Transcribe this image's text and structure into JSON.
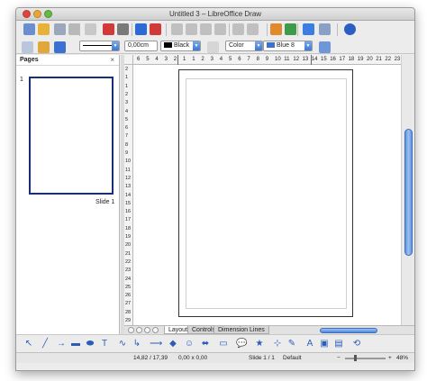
{
  "window": {
    "title": "Untitled 3 – LibreOffice Draw"
  },
  "toolbar_standard": [
    {
      "name": "new-icon",
      "color": "#6a8fd0"
    },
    {
      "name": "open-icon",
      "color": "#e8b13a"
    },
    {
      "name": "save-icon",
      "color": "#9aa7bd"
    },
    {
      "name": "email-icon",
      "color": "#b8b8b8"
    },
    {
      "name": "edit-file-icon",
      "color": "#c8c8c8"
    },
    {
      "name": "export-pdf-icon",
      "color": "#d23a3a"
    },
    {
      "name": "print-icon",
      "color": "#7a7a7a"
    },
    {
      "name": "spellcheck-icon",
      "color": "#2c6bd6"
    },
    {
      "name": "autospellcheck-icon",
      "color": "#d23a3a"
    },
    {
      "name": "cut-icon",
      "color": "#c0c0c0"
    },
    {
      "name": "copy-icon",
      "color": "#c0c0c0"
    },
    {
      "name": "paste-icon",
      "color": "#c0c0c0"
    },
    {
      "name": "clone-formatting-icon",
      "color": "#c0c0c0"
    },
    {
      "name": "undo-icon",
      "color": "#c0c0c0"
    },
    {
      "name": "redo-icon",
      "color": "#c0c0c0"
    },
    {
      "name": "chart-icon",
      "color": "#e08a2c"
    },
    {
      "name": "navigator-icon",
      "color": "#3f9a4a"
    },
    {
      "name": "help-safari-icon",
      "color": "#3b7de0"
    },
    {
      "name": "zoom-pan-icon",
      "color": "#8aa0c4"
    },
    {
      "name": "help-icon",
      "color": "#2c5fc4"
    }
  ],
  "toolbar_line": {
    "line_width": "0,00cm",
    "line_color": "Black",
    "area_style": "Color",
    "area_color": "Blue 8",
    "line_color_swatch": "#000000",
    "area_color_swatch": "#3b72d2"
  },
  "pages_panel": {
    "title": "Pages",
    "close": "×",
    "slide_number": "1",
    "slide_label": "Slide 1"
  },
  "ruler_top": {
    "labels": [
      "6",
      "5",
      "4",
      "3",
      "2",
      "1",
      "1",
      "2",
      "3",
      "4",
      "5",
      "6",
      "7",
      "8",
      "9",
      "10",
      "11",
      "12",
      "13",
      "14",
      "15",
      "16",
      "17",
      "18",
      "19",
      "20",
      "21",
      "22",
      "23"
    ]
  },
  "ruler_left": {
    "labels": [
      "2",
      "1",
      "1",
      "2",
      "3",
      "4",
      "5",
      "6",
      "7",
      "8",
      "9",
      "10",
      "11",
      "12",
      "13",
      "14",
      "15",
      "16",
      "17",
      "18",
      "19",
      "20",
      "21",
      "22",
      "23",
      "24",
      "25",
      "26",
      "27",
      "28",
      "29"
    ]
  },
  "tabs": [
    {
      "label": "Layout",
      "active": true
    },
    {
      "label": "Controls",
      "active": false
    },
    {
      "label": "Dimension Lines",
      "active": false
    }
  ],
  "drawing_toolbar": [
    {
      "name": "select-icon",
      "glyph": "↖"
    },
    {
      "name": "line-icon",
      "glyph": "╱"
    },
    {
      "name": "line-arrow-icon",
      "glyph": "→"
    },
    {
      "name": "rectangle-icon",
      "glyph": "▬"
    },
    {
      "name": "ellipse-icon",
      "glyph": "⬬"
    },
    {
      "name": "text-icon",
      "glyph": "T"
    },
    {
      "name": "curve-icon",
      "glyph": "∿"
    },
    {
      "name": "connector-icon",
      "glyph": "↳"
    },
    {
      "name": "lines-arrows-icon",
      "glyph": "⟶"
    },
    {
      "name": "basic-shapes-icon",
      "glyph": "◆"
    },
    {
      "name": "symbol-shapes-icon",
      "glyph": "☺"
    },
    {
      "name": "block-arrows-icon",
      "glyph": "⬌"
    },
    {
      "name": "flowchart-icon",
      "glyph": "▭"
    },
    {
      "name": "callouts-icon",
      "glyph": "💬"
    },
    {
      "name": "stars-icon",
      "glyph": "★"
    },
    {
      "name": "points-icon",
      "glyph": "⊹"
    },
    {
      "name": "glue-points-icon",
      "glyph": "✎"
    },
    {
      "name": "fontwork-icon",
      "glyph": "A"
    },
    {
      "name": "from-file-icon",
      "glyph": "▣"
    },
    {
      "name": "gallery-icon",
      "glyph": "▤"
    },
    {
      "name": "extrusion-icon",
      "glyph": "⟲"
    }
  ],
  "statusbar": {
    "position": "14,82 / 17,39",
    "size": "0,00 x 0,00",
    "slide": "Slide 1 / 1",
    "layout": "Default",
    "zoom_minus": "−",
    "zoom_plus": "+",
    "zoom": "48%"
  }
}
